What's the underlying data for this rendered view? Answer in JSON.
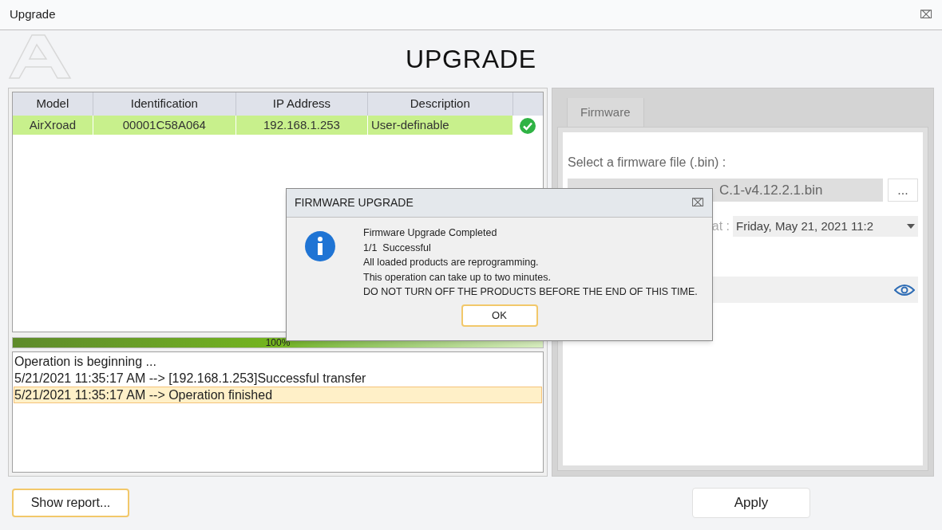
{
  "window": {
    "title": "Upgrade",
    "close": "⌧"
  },
  "header": {
    "title": "UPGRADE"
  },
  "table": {
    "columns": [
      "Model",
      "Identification",
      "IP Address",
      "Description"
    ],
    "rows": [
      {
        "cells": [
          "AirXroad",
          "00001C58A064",
          "192.168.1.253",
          "User-definable"
        ],
        "selected": true,
        "checked": true
      }
    ]
  },
  "progress": {
    "level": 1,
    "label": "100%"
  },
  "log": [
    {
      "text": "Operation is beginning ...",
      "selected": false
    },
    {
      "text": "5/21/2021 11:35:17 AM --> [192.168.1.253]Successful transfer",
      "selected": false
    },
    {
      "text": "5/21/2021 11:35:17 AM --> Operation finished",
      "selected": true
    }
  ],
  "firmware_panel": {
    "tabs": [
      {
        "label": "Firmware",
        "selected": true
      }
    ],
    "file_label": "Select a firmware file (.bin) :",
    "file_value": "C.1-v4.12.2.1.bin",
    "browse": "...",
    "schedule_label": "at :",
    "schedule_value": "Friday, May 21, 2021 11:2"
  },
  "dialog": {
    "title": "FIRMWARE UPGRADE",
    "close": "⌧",
    "lines": [
      "Firmware Upgrade Completed",
      "1/1  Successful",
      "All loaded products are reprogramming.",
      "This operation can take up to two minutes.",
      "DO NOT TURN OFF THE PRODUCTS BEFORE THE END OF THIS TIME."
    ],
    "ok": "OK"
  },
  "buttons": {
    "report": "Show report...",
    "apply": "Apply"
  }
}
